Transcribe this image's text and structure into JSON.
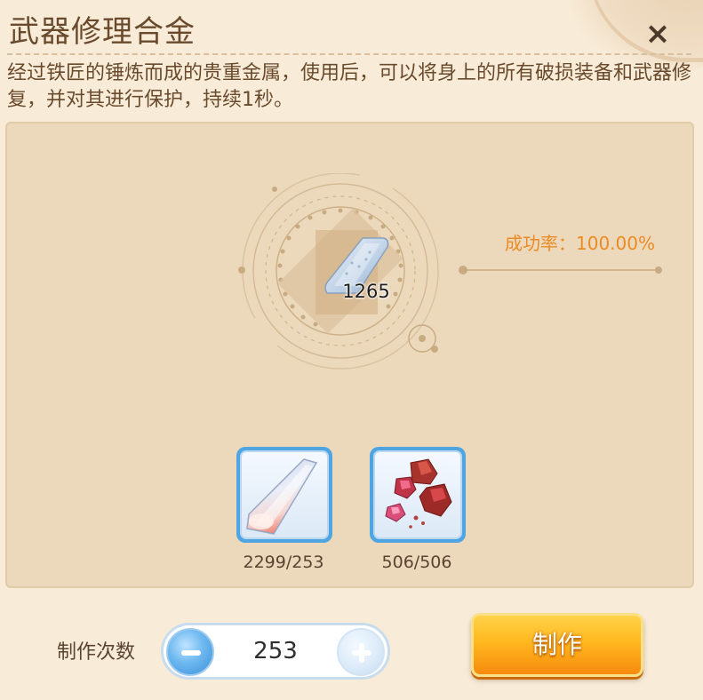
{
  "dialog": {
    "title": "武器修理合金",
    "close_label": "×",
    "description": "经过铁匠的锤炼而成的贵重金属，使用后，可以将身上的所有破损装备和武器修复，并对其进行保护，持续1秒。"
  },
  "preview": {
    "item_icon": "alloy-plate-icon",
    "item_count": "1265",
    "success_rate": "成功率：100.00%"
  },
  "materials": [
    {
      "icon": "alloy-plate-icon",
      "count": "2299/253"
    },
    {
      "icon": "red-ore-icon",
      "count": "506/506"
    }
  ],
  "craft_controls": {
    "count_label": "制作次数",
    "count_value": "253",
    "craft_button": "制作"
  },
  "colors": {
    "background": "#f8ecd9",
    "panel": "#ecd9bc",
    "accent_orange": "#ec8a24",
    "button_orange": "#ffb81f",
    "frame_blue": "#4fa4e2"
  }
}
